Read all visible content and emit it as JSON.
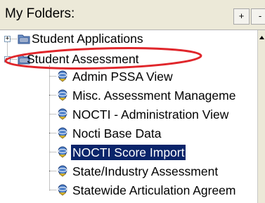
{
  "header": {
    "title": "My Folders:",
    "expand_all_label": "+",
    "collapse_all_label": "-"
  },
  "tree": {
    "folders": [
      {
        "label": "Student Applications",
        "expanded": false
      },
      {
        "label": "Student Assessment",
        "expanded": true,
        "highlighted": true
      }
    ],
    "items": [
      {
        "label": "Admin PSSA View"
      },
      {
        "label": "Misc. Assessment Manageme"
      },
      {
        "label": "NOCTI - Administration View"
      },
      {
        "label": "Nocti Base Data"
      },
      {
        "label": "NOCTI Score Import",
        "selected": true
      },
      {
        "label": "State/Industry Assessment"
      },
      {
        "label": "Statewide Articulation Agreem"
      }
    ]
  },
  "colors": {
    "selection_bg": "#0a246a",
    "annotation": "#e0262b",
    "header_bg": "#ece9d8"
  },
  "icons": {
    "folder": "folder-icon",
    "report": "report-icon",
    "scroll_up": "scroll-up-arrow-icon"
  }
}
